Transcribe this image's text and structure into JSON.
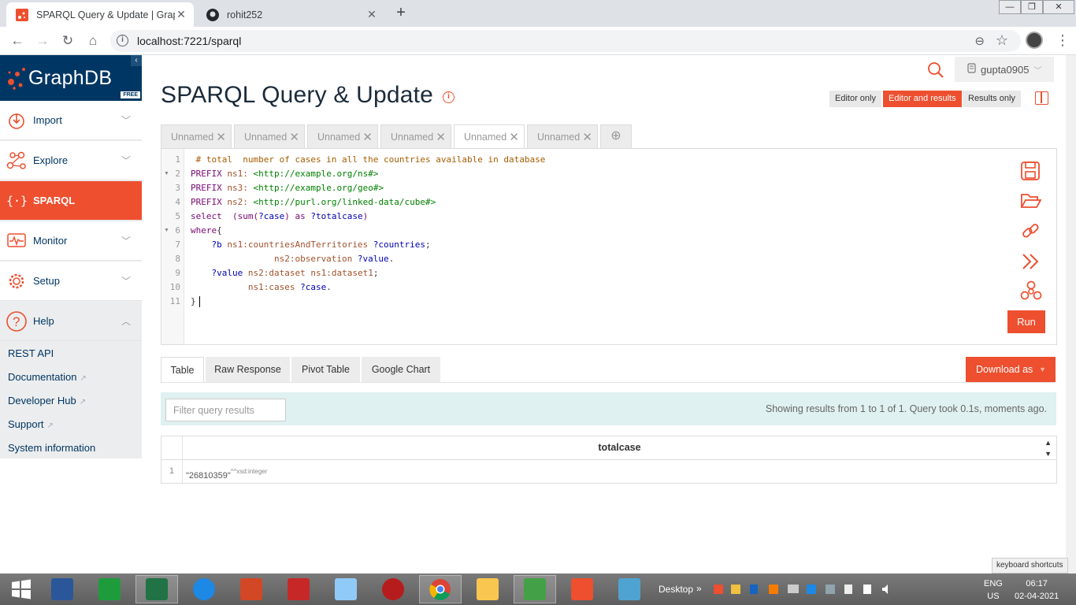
{
  "browser": {
    "tabs": [
      {
        "title": "SPARQL Query & Update | Graph",
        "active": true
      },
      {
        "title": "rohit252",
        "active": false
      }
    ],
    "new_tab": "+",
    "url": "localhost:7221/sparql",
    "window_controls": [
      "—",
      "❐",
      "✕"
    ]
  },
  "sidebar": {
    "brand": "GraphDB",
    "badge": "FREE",
    "collapse": "‹",
    "items": [
      {
        "label": "Import",
        "icon": "import-icon",
        "active": false
      },
      {
        "label": "Explore",
        "icon": "explore-icon",
        "active": false
      },
      {
        "label": "SPARQL",
        "icon": "sparql-icon",
        "active": true
      },
      {
        "label": "Monitor",
        "icon": "monitor-icon",
        "active": false
      },
      {
        "label": "Setup",
        "icon": "setup-icon",
        "active": false
      }
    ],
    "help": {
      "label": "Help",
      "icon": "help-icon"
    },
    "help_links": [
      {
        "label": "REST API",
        "external": false
      },
      {
        "label": "Documentation",
        "external": true
      },
      {
        "label": "Developer Hub",
        "external": true
      },
      {
        "label": "Support",
        "external": true
      },
      {
        "label": "System information",
        "external": false
      }
    ]
  },
  "header": {
    "title": "SPARQL Query & Update",
    "user": "gupta0905",
    "view_modes": [
      {
        "label": "Editor only",
        "active": false
      },
      {
        "label": "Editor and results",
        "active": true
      },
      {
        "label": "Results only",
        "active": false
      }
    ]
  },
  "query_tabs": [
    "Unnamed",
    "Unnamed",
    "Unnamed",
    "Unnamed",
    "Unnamed",
    "Unnamed"
  ],
  "active_query_tab": 4,
  "editor": {
    "line_numbers": [
      "1",
      "2",
      "3",
      "4",
      "5",
      "6",
      "7",
      "8",
      "9",
      "10",
      "11"
    ],
    "lines": {
      "l1": " # total  number of cases in all the countries available in database",
      "l2_kw": "PREFIX",
      "l2_pn": " ns1:",
      "l2_iri": " <http://example.org/ns#>",
      "l3_kw": "PREFIX",
      "l3_pn": " ns3:",
      "l3_iri": " <http://example.org/geo#>",
      "l4_kw": "PREFIX",
      "l4_pn": " ns2:",
      "l4_iri": " <http://purl.org/linked-data/cube#>",
      "l5_a": "select",
      "l5_b": "  (sum(",
      "l5_c": "?case",
      "l5_d": ") ",
      "l5_e": "as",
      "l5_f": " ?totalcase",
      "l5_g": ")",
      "l6_kw": "where",
      "l6_b": "{",
      "l7_a": "    ?b",
      "l7_b": " ns1:countriesAndTerritories",
      "l7_c": " ?countries",
      "l7_d": ";",
      "l8_a": "                ns2:observation",
      "l8_b": " ?value",
      "l8_c": ".",
      "l9_a": "    ?value",
      "l9_b": " ns2:dataset",
      "l9_c": " ns1:dataset1",
      "l9_d": ";",
      "l10_a": "           ns1:cases",
      "l10_b": " ?case",
      "l10_c": ".",
      "l11": "}"
    },
    "run_label": "Run"
  },
  "results": {
    "tabs": [
      {
        "label": "Table",
        "active": true
      },
      {
        "label": "Raw Response",
        "active": false
      },
      {
        "label": "Pivot Table",
        "active": false
      },
      {
        "label": "Google Chart",
        "active": false
      }
    ],
    "download_label": "Download as",
    "filter_placeholder": "Filter query results",
    "status": "Showing results from 1 to 1 of 1. Query took 0.1s, moments ago.",
    "column": "totalcase",
    "rows": [
      {
        "n": "1",
        "value": "\"26810359\"",
        "datatype": "^^xsd:integer"
      }
    ]
  },
  "keyboard_shortcuts": "keyboard shortcuts",
  "taskbar": {
    "desktop_label": "Desktop",
    "lang_top": "ENG",
    "lang_bottom": "US",
    "time": "06:17",
    "date": "02-04-2021"
  },
  "colors": {
    "accent": "#ed4f2f",
    "brand": "#003663"
  }
}
